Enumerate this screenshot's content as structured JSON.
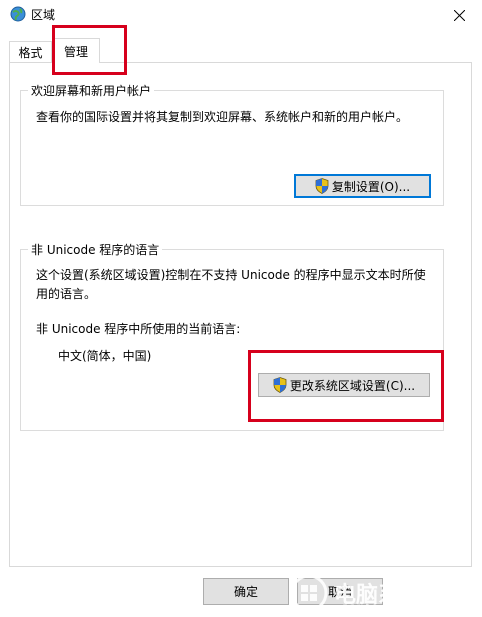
{
  "window": {
    "title": "区域",
    "close_icon": "close-icon",
    "app_icon": "globe-icon"
  },
  "tabs": [
    {
      "label": "格式",
      "selected": false
    },
    {
      "label": "管理",
      "selected": true
    }
  ],
  "welcome_group": {
    "title": "欢迎屏幕和新用户帐户",
    "description": "查看你的国际设置并将其复制到欢迎屏幕、系统帐户和新的用户帐户。",
    "copy_button": "复制设置(O)..."
  },
  "unicode_group": {
    "title": "非 Unicode 程序的语言",
    "description": "这个设置(系统区域设置)控制在不支持 Unicode 的程序中显示文本时所使用的语言。",
    "current_label": "非 Unicode 程序中所使用的当前语言:",
    "current_value": "中文(简体，中国)",
    "change_button": "更改系统区域设置(C)..."
  },
  "footer": {
    "ok_button": "确定",
    "cancel_button": "取消"
  },
  "watermark": {
    "text": "电脑系统城",
    "sub": "dnxtc.net"
  },
  "colors": {
    "highlight_box": "#d6001c",
    "focus_border": "#0078d7",
    "button_face": "#e1e1e1"
  }
}
